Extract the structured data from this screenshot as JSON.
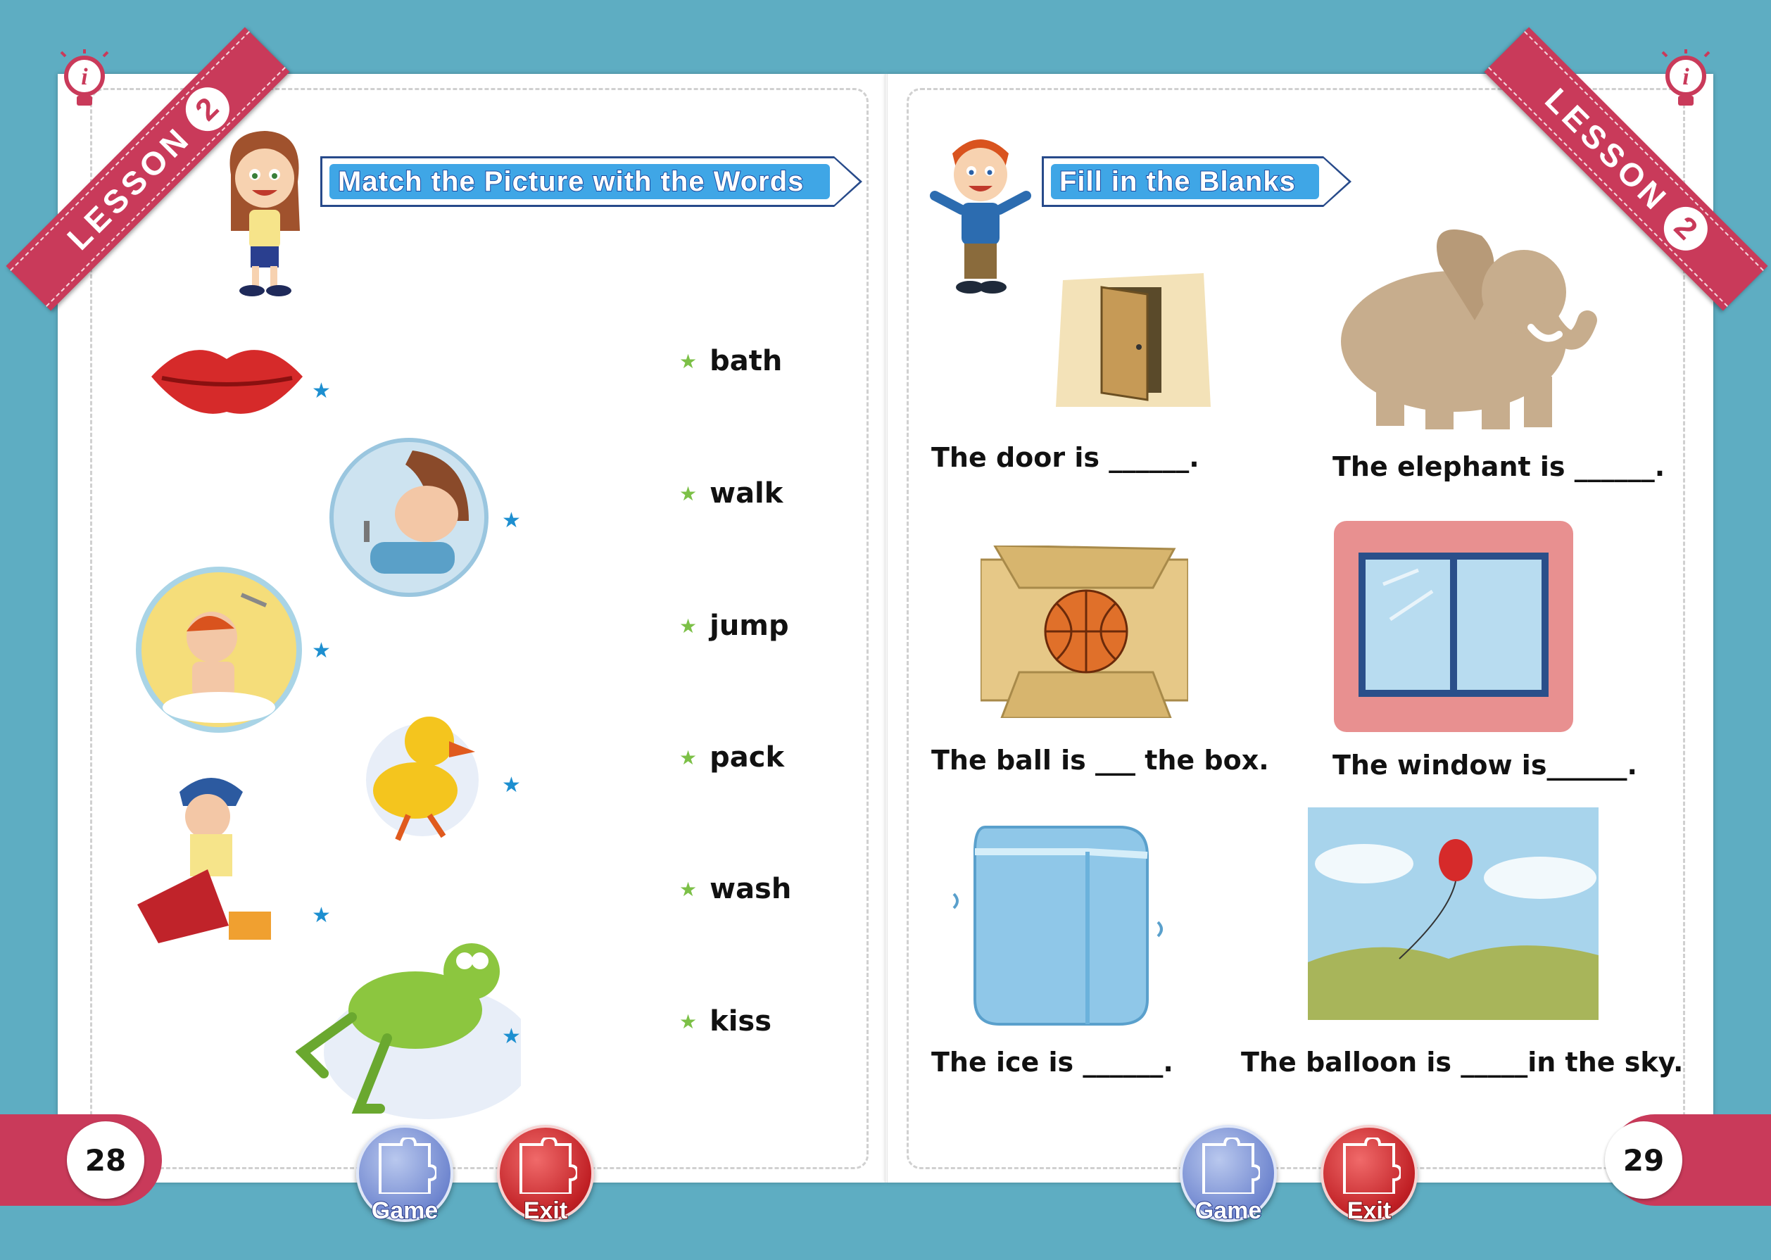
{
  "ribbons": {
    "label": "LESSON",
    "number": "2"
  },
  "left_page": {
    "heading": "Match the Picture with the Words",
    "words": [
      "bath",
      "walk",
      "jump",
      "pack",
      "wash",
      "kiss"
    ],
    "page_number": "28"
  },
  "right_page": {
    "heading": "Fill in the Blanks",
    "sentences": {
      "door": "The door is ______.",
      "elephant": "The elephant is ______.",
      "ball": "The ball is ___ the box.",
      "window": "The window is______.",
      "ice": "The ice is ______.",
      "balloon": "The balloon is _____in the sky."
    },
    "page_number": "29"
  },
  "buttons": {
    "game": "Game",
    "exit": "Exit"
  }
}
